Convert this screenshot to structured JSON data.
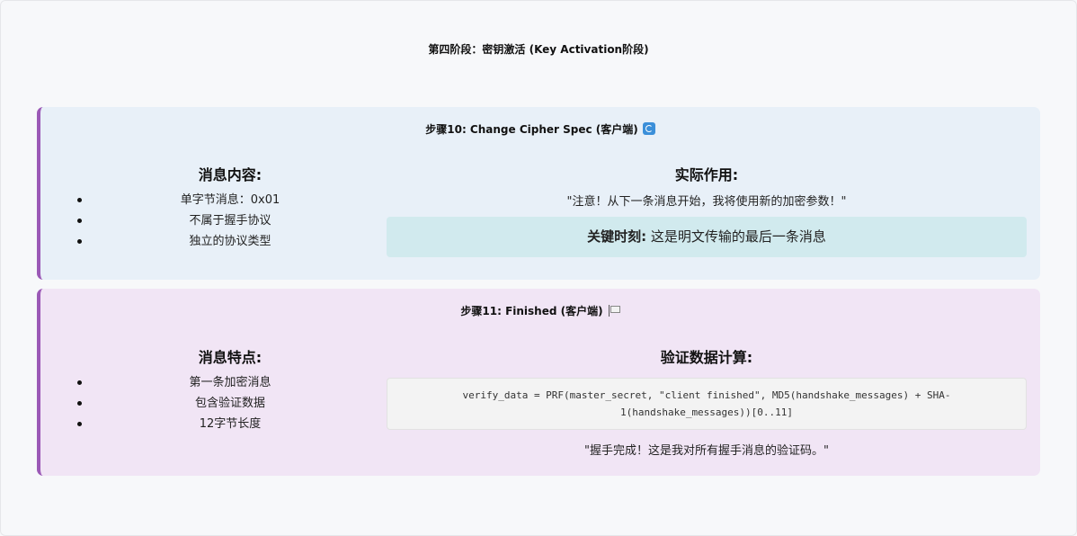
{
  "stage_title": "第四阶段：密钥激活 (Key Activation阶段)",
  "step10": {
    "title": "步骤10: Change Cipher Spec (客户端)",
    "icon": "refresh-icon",
    "left_heading": "消息内容:",
    "left_items": [
      "单字节消息：0x01",
      "不属于握手协议",
      "独立的协议类型"
    ],
    "right_heading": "实际作用:",
    "quote": "\"注意！从下一条消息开始，我将使用新的加密参数！\"",
    "highlight_label": "关键时刻:",
    "highlight_text": " 这是明文传输的最后一条消息"
  },
  "step11": {
    "title": "步骤11: Finished (客户端)",
    "icon": "flag-icon",
    "left_heading": "消息特点:",
    "left_items": [
      "第一条加密消息",
      "包含验证数据",
      "12字节长度"
    ],
    "right_heading": "验证数据计算:",
    "code": "verify_data = PRF(master_secret, \"client finished\", MD5(handshake_messages) + SHA-1(handshake_messages))[0..11]",
    "quote": "\"握手完成！这是我对所有握手消息的验证码。\""
  },
  "colors": {
    "accent_border": "#9b59b6",
    "card_blue": "#e8f0f8",
    "card_purple": "#f1e5f5",
    "highlight": "#d1eaee"
  }
}
